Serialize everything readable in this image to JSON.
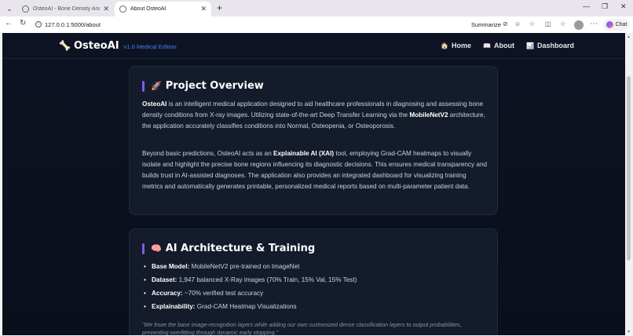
{
  "browser": {
    "tabs": [
      {
        "title": "OsteoAI - Bone Density Analysis",
        "active": false
      },
      {
        "title": "About OsteoAI",
        "active": true
      }
    ],
    "url": "127.0.0.1:5000/about",
    "summarize_label": "Summarize",
    "chat_label": "Chat"
  },
  "nav": {
    "brand": "OsteoAI",
    "edition": "v1.0 Medical Edition",
    "links": [
      {
        "icon": "🏠",
        "label": "Home"
      },
      {
        "icon": "📖",
        "label": "About"
      },
      {
        "icon": "📊",
        "label": "Dashboard"
      }
    ]
  },
  "overview": {
    "icon": "🚀",
    "title": "Project Overview",
    "p1_strong": "OsteoAI",
    "p1_a": " is an intelligent medical application designed to aid healthcare professionals in diagnosing and assessing bone density conditions from X-ray images. Utilizing state-of-the-art Deep Transfer Learning via the ",
    "p1_strong2": "MobileNetV2",
    "p1_b": " architecture, the application accurately classifies conditions into Normal, Osteopenia, or Osteoporosis.",
    "p2_a": "Beyond basic predictions, OsteoAI acts as an ",
    "p2_strong": "Explainable AI (XAI)",
    "p2_b": " tool, employing Grad-CAM heatmaps to visually isolate and highlight the precise bone regions influencing its diagnostic decisions. This ensures medical transparency and builds trust in AI-assisted diagnoses. The application also provides an integrated dashboard for visualizing training metrics and automatically generates printable, personalized medical reports based on multi-parameter patient data."
  },
  "architecture": {
    "icon": "🧠",
    "title": "AI Architecture & Training",
    "items": [
      {
        "label": "Base Model:",
        "value": " MobileNetV2 pre-trained on ImageNet"
      },
      {
        "label": "Dataset:",
        "value": " 1,947 balanced X-Ray images (70% Train, 15% Val, 15% Test)"
      },
      {
        "label": "Accuracy:",
        "value": " ~70% verified test accuracy"
      },
      {
        "label": "Explainability:",
        "value": " Grad-CAM Heatmap Visualizations"
      }
    ],
    "quote": "\"We froze the base image-recognition layers while adding our own customized dense classification layers to output probabilities, preventing overfitting through dynamic early stopping.\""
  },
  "colors": {
    "accent": "#7c5cf0",
    "brand_edition": "#3b82f6",
    "background": "#0d1322",
    "card": "#141b2b"
  }
}
